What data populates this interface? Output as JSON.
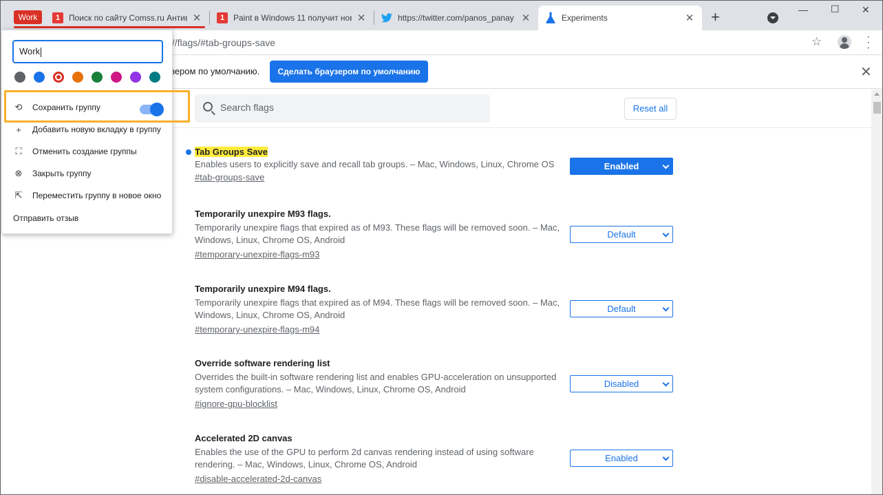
{
  "tabs": {
    "group_label": "Work",
    "group_color": "#d93025",
    "items": [
      {
        "title": "Поиск по сайту Comss.ru Антив",
        "favicon": "comss-logo-icon"
      },
      {
        "title": "Paint в Windows 11 получит нов",
        "favicon": "comss-logo-icon"
      },
      {
        "title": "https://twitter.com/panos_panay",
        "favicon": "twitter-bird-icon"
      },
      {
        "title": "Experiments",
        "favicon": "flask-icon",
        "active": true
      }
    ],
    "favicon_letter": "1"
  },
  "toolbar": {
    "url": "://flags/#tab-groups-save"
  },
  "infobar": {
    "text": "зером по умолчанию.",
    "button": "Сделать браузером по умолчанию"
  },
  "flags_header": {
    "search_placeholder": "Search flags",
    "reset_label": "Reset all"
  },
  "flags": [
    {
      "name": "Tab Groups Save",
      "description": "Enables users to explicitly save and recall tab groups. – Mac, Windows, Linux, Chrome OS",
      "link": "#tab-groups-save",
      "state": "Enabled",
      "modified": true
    },
    {
      "name": "Temporarily unexpire M93 flags.",
      "description": "Temporarily unexpire flags that expired as of M93. These flags will be removed soon. – Mac, Windows, Linux, Chrome OS, Android",
      "link": "#temporary-unexpire-flags-m93",
      "state": "Default"
    },
    {
      "name": "Temporarily unexpire M94 flags.",
      "description": "Temporarily unexpire flags that expired as of M94. These flags will be removed soon. – Mac, Windows, Linux, Chrome OS, Android",
      "link": "#temporary-unexpire-flags-m94",
      "state": "Default"
    },
    {
      "name": "Override software rendering list",
      "description": "Overrides the built-in software rendering list and enables GPU-acceleration on unsupported system configurations. – Mac, Windows, Linux, Chrome OS, Android",
      "link": "#ignore-gpu-blocklist",
      "state": "Disabled"
    },
    {
      "name": "Accelerated 2D canvas",
      "description": "Enables the use of the GPU to perform 2d canvas rendering instead of using software rendering. – Mac, Windows, Linux, Chrome OS, Android",
      "link": "#disable-accelerated-2d-canvas",
      "state": "Enabled"
    }
  ],
  "popup": {
    "group_name": "Work",
    "colors": [
      "#5f6368",
      "#1a73e8",
      "#d93025",
      "#e8710a",
      "#188038",
      "#d01884",
      "#9334e6",
      "#007b83"
    ],
    "selected_color_index": 2,
    "save_group": {
      "label": "Сохранить группу",
      "on": true
    },
    "menu": [
      {
        "label": "Добавить новую вкладку в группу",
        "icon": "plus-icon"
      },
      {
        "label": "Отменить создание группы",
        "icon": "ungroup-icon"
      },
      {
        "label": "Закрыть группу",
        "icon": "close-circle-icon"
      },
      {
        "label": "Переместить группу в новое окно",
        "icon": "move-window-icon"
      }
    ],
    "feedback": "Отправить отзыв"
  }
}
